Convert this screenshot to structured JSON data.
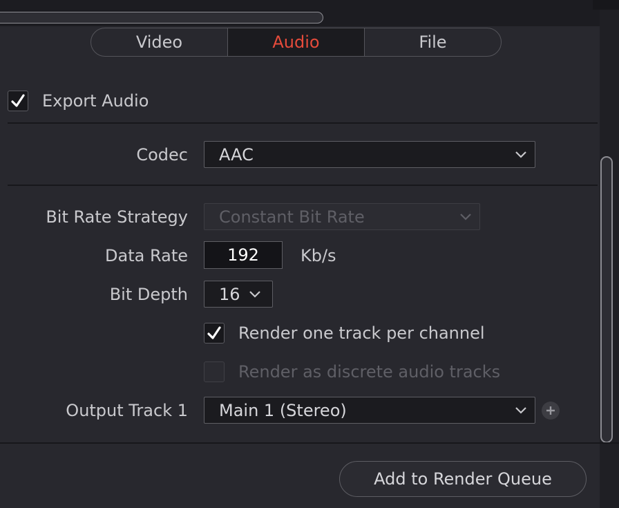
{
  "tabs": [
    {
      "label": "Video"
    },
    {
      "label": "Audio"
    },
    {
      "label": "File"
    }
  ],
  "active_tab": "Audio",
  "accent_color": "#e64b3b",
  "export_audio": {
    "label": "Export Audio",
    "checked": true
  },
  "codec": {
    "label": "Codec",
    "value": "AAC",
    "icon": "chevron-down-icon"
  },
  "bit_rate_strategy": {
    "label": "Bit Rate Strategy",
    "value": "Constant Bit Rate",
    "enabled": false
  },
  "data_rate": {
    "label": "Data Rate",
    "value": "192",
    "unit": "Kb/s"
  },
  "bit_depth": {
    "label": "Bit Depth",
    "value": "16"
  },
  "render_one_track": {
    "label": "Render one track per channel",
    "checked": true
  },
  "render_discrete": {
    "label": "Render as discrete audio tracks",
    "checked": false,
    "enabled": false
  },
  "output_track": {
    "label": "Output Track 1",
    "value": "Main 1 (Stereo)",
    "add_icon": "plus-icon"
  },
  "add_to_render_queue": {
    "label": "Add to Render Queue"
  }
}
